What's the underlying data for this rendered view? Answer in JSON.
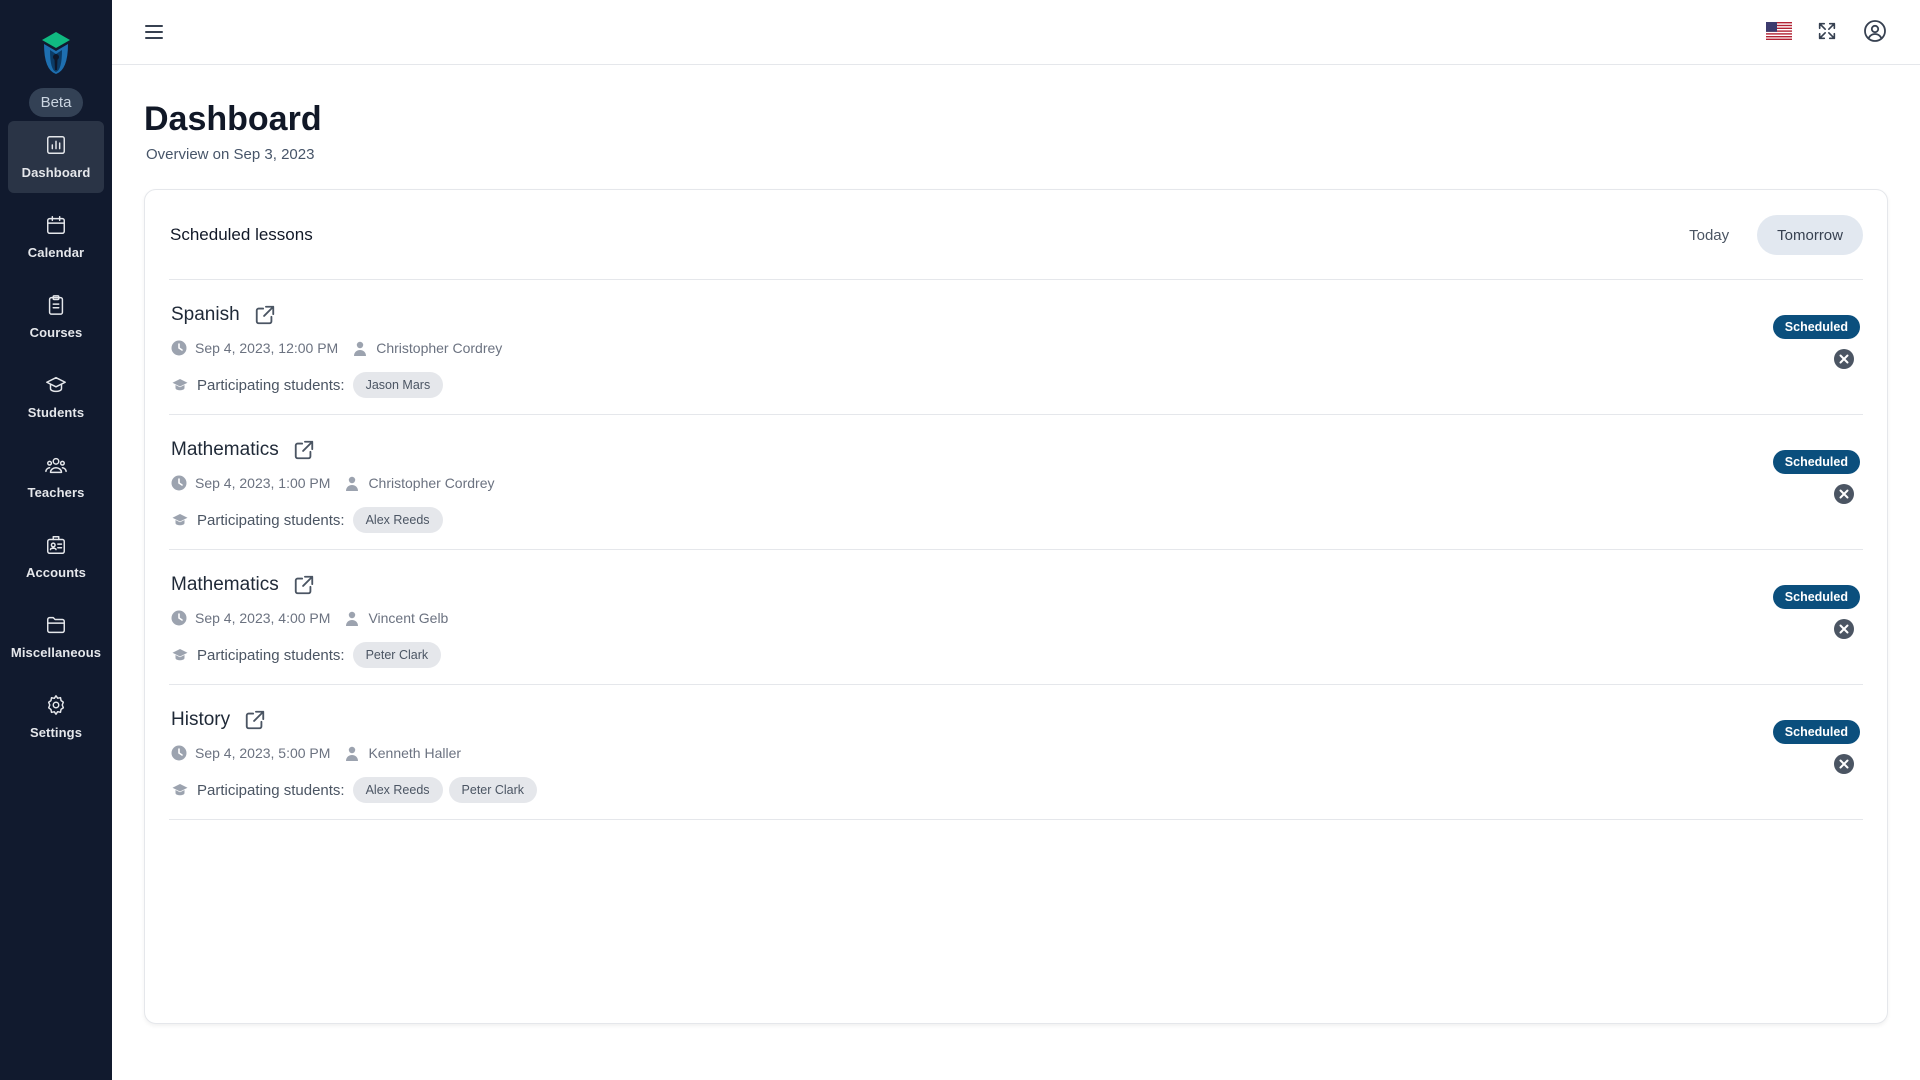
{
  "app": {
    "badge": "Beta",
    "colors": {
      "sidebar": "#111a2e",
      "status": "#0b4f7d",
      "active_nav": "#2a3446"
    }
  },
  "sidebar": {
    "items": [
      {
        "label": "Dashboard",
        "icon": "bar-chart-icon",
        "active": true
      },
      {
        "label": "Calendar",
        "icon": "calendar-icon",
        "active": false
      },
      {
        "label": "Courses",
        "icon": "clipboard-icon",
        "active": false
      },
      {
        "label": "Students",
        "icon": "graduation-cap-icon",
        "active": false
      },
      {
        "label": "Teachers",
        "icon": "users-icon",
        "active": false
      },
      {
        "label": "Accounts",
        "icon": "id-badge-icon",
        "active": false
      },
      {
        "label": "Miscellaneous",
        "icon": "folder-icon",
        "active": false
      },
      {
        "label": "Settings",
        "icon": "gear-icon",
        "active": false
      }
    ]
  },
  "topbar": {
    "icons": [
      "menu-icon",
      "us-flag-icon",
      "fullscreen-icon",
      "user-circle-icon"
    ]
  },
  "header": {
    "title": "Dashboard",
    "subtitle": "Overview on Sep 3, 2023"
  },
  "lessons_card": {
    "title": "Scheduled lessons",
    "tabs": [
      {
        "label": "Today",
        "active": false
      },
      {
        "label": "Tomorrow",
        "active": true
      }
    ],
    "participants_label": "Participating students:",
    "lessons": [
      {
        "subject": "Spanish",
        "datetime": "Sep 4, 2023, 12:00 PM",
        "teacher": "Christopher Cordrey",
        "students": [
          "Jason Mars"
        ],
        "status": "Scheduled"
      },
      {
        "subject": "Mathematics",
        "datetime": "Sep 4, 2023, 1:00 PM",
        "teacher": "Christopher Cordrey",
        "students": [
          "Alex Reeds"
        ],
        "status": "Scheduled"
      },
      {
        "subject": "Mathematics",
        "datetime": "Sep 4, 2023, 4:00 PM",
        "teacher": "Vincent Gelb",
        "students": [
          "Peter Clark"
        ],
        "status": "Scheduled"
      },
      {
        "subject": "History",
        "datetime": "Sep 4, 2023, 5:00 PM",
        "teacher": "Kenneth Haller",
        "students": [
          "Alex Reeds",
          "Peter Clark"
        ],
        "status": "Scheduled"
      }
    ]
  }
}
